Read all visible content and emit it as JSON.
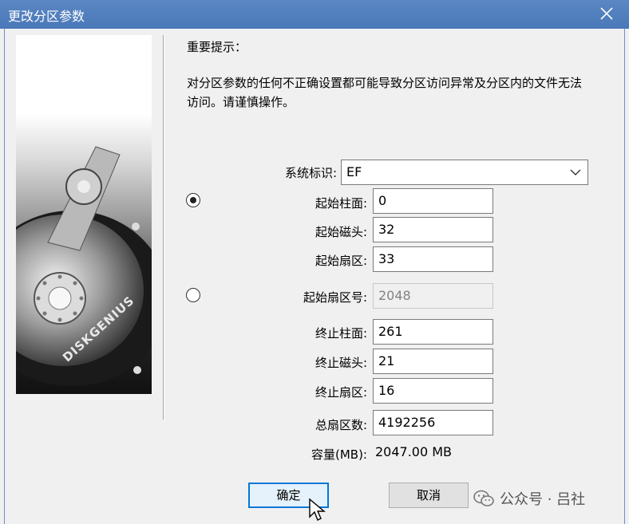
{
  "window": {
    "title": "更改分区参数"
  },
  "warning": {
    "heading": "重要提示：",
    "text": "对分区参数的任何不正确设置都可能导致分区访问异常及分区内的文件无法访问。请谨慎操作。"
  },
  "side_image": {
    "brand_text": "DISKGENIUS"
  },
  "form": {
    "system_id": {
      "label": "系统标识:",
      "value": "EF"
    },
    "chs_start": {
      "selected": true,
      "cylinder": {
        "label": "起始柱面:",
        "value": "0"
      },
      "head": {
        "label": "起始磁头:",
        "value": "32"
      },
      "sector": {
        "label": "起始扇区:",
        "value": "33"
      }
    },
    "lba_start": {
      "selected": false,
      "label": "起始扇区号:",
      "value": "2048"
    },
    "end_cylinder": {
      "label": "终止柱面:",
      "value": "261"
    },
    "end_head": {
      "label": "终止磁头:",
      "value": "21"
    },
    "end_sector": {
      "label": "终止扇区:",
      "value": "16"
    },
    "total_sectors": {
      "label": "总扇区数:",
      "value": "4192256"
    },
    "capacity": {
      "label": "容量(MB):",
      "value": "2047.00 MB"
    }
  },
  "buttons": {
    "ok": "确定",
    "cancel": "取消"
  },
  "watermark": {
    "text": "公众号 · 吕社"
  },
  "icons": {
    "close": "close-icon",
    "dropdown": "chevron-down-icon",
    "cursor": "mouse-pointer-icon",
    "wechat": "wechat-icon"
  }
}
